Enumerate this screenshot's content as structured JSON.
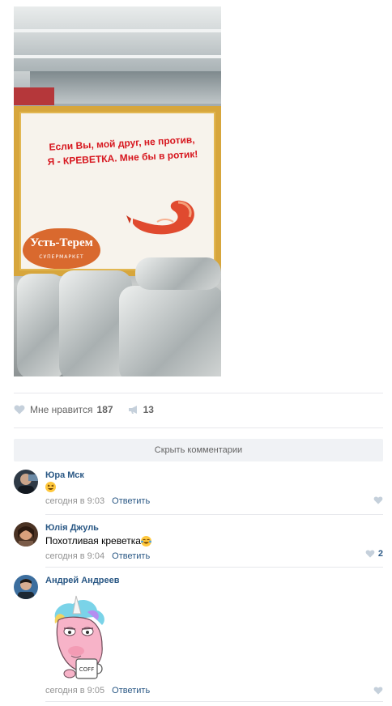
{
  "post": {
    "photo": {
      "sign_line1": "Если Вы, мой друг, не против,",
      "sign_line2": "Я - КРЕВЕТКА. Мне бы в ротик!",
      "logo_text": "Усть-Терем",
      "logo_sub": "СУПЕРМАРКЕТ"
    },
    "likes": {
      "label": "Мне нравится",
      "count": "187",
      "icon": "heart-icon"
    },
    "shares": {
      "count": "13",
      "icon": "megaphone-icon"
    }
  },
  "comments_toggle": {
    "label": "Скрыть комментарии"
  },
  "comments": [
    {
      "author": "Юра Мск",
      "text": "",
      "emoji": "grinning-squint-emoji",
      "time": "сегодня в 9:03",
      "reply": "Ответить",
      "likes": ""
    },
    {
      "author": "Юлія Джуль",
      "text": "Похотливая креветка",
      "emoji": "tears-of-joy-emoji",
      "time": "сегодня в 9:04",
      "reply": "Ответить",
      "likes": "2"
    },
    {
      "author": "Андрей Андреев",
      "text": "",
      "sticker": "unicorn-coffee-sticker",
      "sticker_text": "COFF",
      "time": "сегодня в 9:05",
      "reply": "Ответить",
      "likes": ""
    }
  ],
  "colors": {
    "link": "#2a5885",
    "meta": "#939393",
    "divider": "#e7e8ec",
    "button_bg": "#f0f2f5"
  }
}
